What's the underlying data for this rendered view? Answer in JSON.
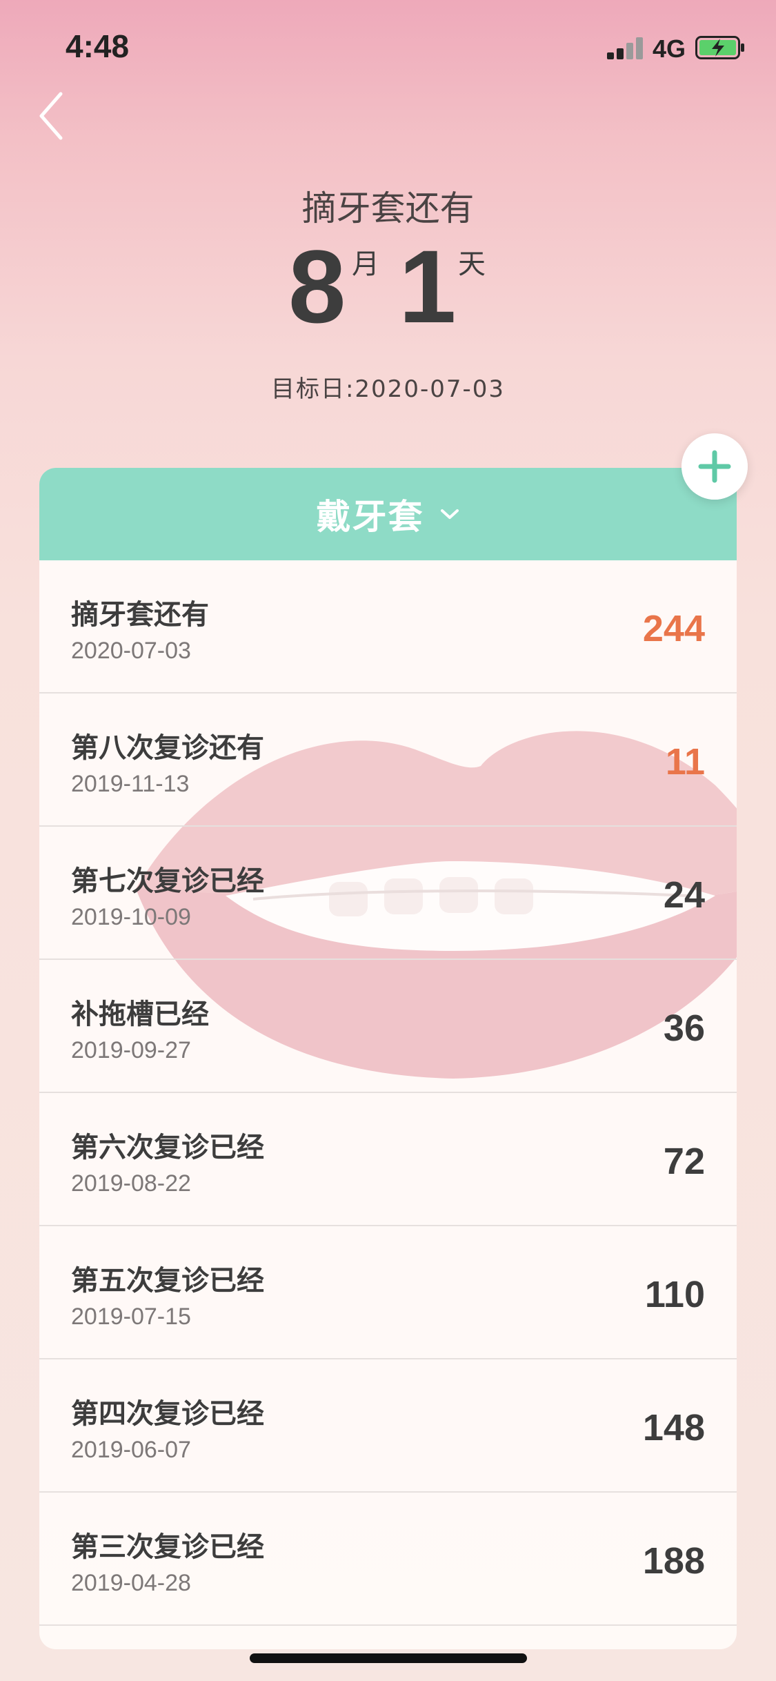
{
  "status_bar": {
    "time": "4:48",
    "network": "4G"
  },
  "countdown": {
    "title": "摘牙套还有",
    "months": "8",
    "month_unit": "月",
    "days": "1",
    "day_unit": "天",
    "target": "目标日:2020-07-03"
  },
  "card": {
    "category": "戴牙套",
    "items": [
      {
        "title": "摘牙套还有",
        "date": "2020-07-03",
        "count": "244",
        "highlight": true
      },
      {
        "title": "第八次复诊还有",
        "date": "2019-11-13",
        "count": "11",
        "highlight": true
      },
      {
        "title": "第七次复诊已经",
        "date": "2019-10-09",
        "count": "24",
        "highlight": false
      },
      {
        "title": "补拖槽已经",
        "date": "2019-09-27",
        "count": "36",
        "highlight": false
      },
      {
        "title": "第六次复诊已经",
        "date": "2019-08-22",
        "count": "72",
        "highlight": false
      },
      {
        "title": "第五次复诊已经",
        "date": "2019-07-15",
        "count": "110",
        "highlight": false
      },
      {
        "title": "第四次复诊已经",
        "date": "2019-06-07",
        "count": "148",
        "highlight": false
      },
      {
        "title": "第三次复诊已经",
        "date": "2019-04-28",
        "count": "188",
        "highlight": false
      }
    ]
  },
  "colors": {
    "accent_count": "#e9754a",
    "header_green": "#8edbc6",
    "plus_green": "#5fc9a6"
  },
  "icons": {
    "back": "chevron-left-icon",
    "dropdown": "chevron-down-icon",
    "add": "plus-icon",
    "watermark": "lips-braces-illustration"
  }
}
